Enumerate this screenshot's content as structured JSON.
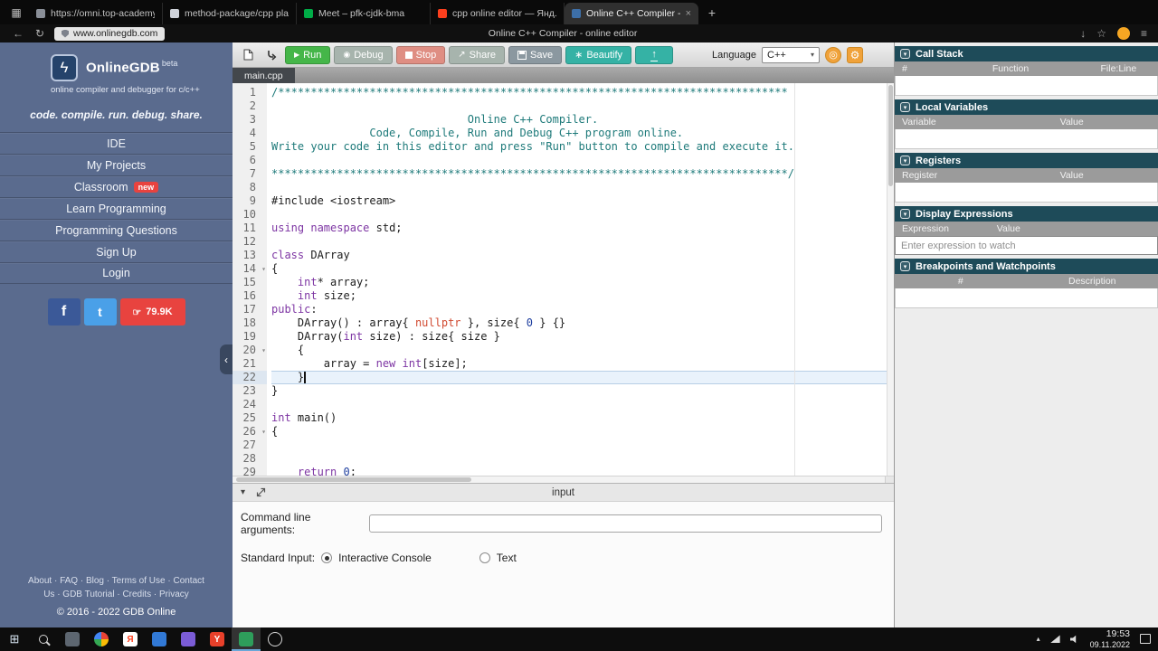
{
  "colors": {
    "run_green": "#45b649",
    "stop_red": "#df8e83",
    "neutral_btn": "#a7b4ad",
    "save_gray": "#8b98a0",
    "teal": "#35b2a5",
    "orange": "#f0a23a",
    "sidebar": "#5a6b8e",
    "badge_red": "#e8433f",
    "panel_header": "#1e4b59",
    "facebook": "#3b5998",
    "twitter": "#4aa0e8"
  },
  "icons": {
    "window": "▦",
    "plus": "+",
    "close": "×",
    "back": "←",
    "refresh": "↻",
    "star": "☆",
    "download": "↓",
    "menu": "≡",
    "facebook": "f",
    "twitter": "t",
    "hand": "☞",
    "play": "▶",
    "gear": "⚙",
    "coin": "◎",
    "chevron_down": "▾",
    "chevron_left": "‹",
    "chevron_up": "▴",
    "start": "⊞",
    "bolt": "ϟ",
    "beautify": "∗",
    "share": "↗",
    "debug": "◉"
  },
  "browser": {
    "tabs": [
      {
        "title": "https://omni.top-academy",
        "fav": "#8a8f98",
        "active": false
      },
      {
        "title": "method-package/cpp plan",
        "fav": "#cfd3da",
        "active": false
      },
      {
        "title": "Meet – pfk-cjdk-bma",
        "fav": "#00ac47",
        "active": false
      },
      {
        "title": "cpp online editor — Янд...",
        "fav": "#fc3f1d",
        "active": false
      },
      {
        "title": "Online C++ Compiler - o...",
        "fav": "#3d6fa8",
        "active": true
      }
    ],
    "url": "www.onlinegdb.com",
    "page_title": "Online C++ Compiler - online editor"
  },
  "sidebar": {
    "brand": "OnlineGDB",
    "beta": "beta",
    "brand_sub": "online compiler and debugger for c/c++",
    "tagline": "code. compile. run. debug. share.",
    "menu": [
      {
        "label": "IDE"
      },
      {
        "label": "My Projects"
      },
      {
        "label": "Classroom",
        "badge": "new"
      },
      {
        "label": "Learn Programming"
      },
      {
        "label": "Programming Questions"
      },
      {
        "label": "Sign Up"
      },
      {
        "label": "Login"
      }
    ],
    "like_count": "79.9K",
    "footer_links": [
      "About",
      "FAQ",
      "Blog",
      "Terms of Use",
      "Contact Us",
      "GDB Tutorial",
      "Credits",
      "Privacy"
    ],
    "copyright": "© 2016 - 2022 GDB Online"
  },
  "toolbar": {
    "run": "Run",
    "debug": "Debug",
    "stop": "Stop",
    "share": "Share",
    "save": "Save",
    "beautify": "Beautify",
    "language_label": "Language",
    "language_value": "C++"
  },
  "editor": {
    "file_tab": "main.cpp",
    "cursor_line": 22,
    "cursor_col": 5,
    "fold_lines": [
      14,
      20,
      26
    ],
    "token_colors": {
      "c": "#1e7a7a",
      "k": "#7d35a3",
      "v": "#d14b32",
      "n": "#2040a0",
      "t": "#1d1d1d"
    },
    "lines": [
      [
        [
          "c",
          "/******************************************************************************"
        ]
      ],
      [],
      [
        [
          "c",
          "                              Online C++ Compiler."
        ]
      ],
      [
        [
          "c",
          "               Code, Compile, Run and Debug C++ program online."
        ]
      ],
      [
        [
          "c",
          "Write your code in this editor and press \"Run\" button to compile and execute it."
        ]
      ],
      [],
      [
        [
          "c",
          "*******************************************************************************/"
        ]
      ],
      [],
      [
        [
          "t",
          "#include <iostream>"
        ]
      ],
      [],
      [
        [
          "k",
          "using"
        ],
        [
          "t",
          " "
        ],
        [
          "k",
          "namespace"
        ],
        [
          "t",
          " std;"
        ]
      ],
      [],
      [
        [
          "k",
          "class"
        ],
        [
          "t",
          " DArray"
        ]
      ],
      [
        [
          "t",
          "{"
        ]
      ],
      [
        [
          "t",
          "    "
        ],
        [
          "k",
          "int"
        ],
        [
          "t",
          "* array;"
        ]
      ],
      [
        [
          "t",
          "    "
        ],
        [
          "k",
          "int"
        ],
        [
          "t",
          " size;"
        ]
      ],
      [
        [
          "k",
          "public"
        ],
        [
          "t",
          ":"
        ]
      ],
      [
        [
          "t",
          "    DArray() : array{ "
        ],
        [
          "v",
          "nullptr"
        ],
        [
          "t",
          " }, size{ "
        ],
        [
          "n",
          "0"
        ],
        [
          "t",
          " } {}"
        ]
      ],
      [
        [
          "t",
          "    DArray("
        ],
        [
          "k",
          "int"
        ],
        [
          "t",
          " size) : size{ size }"
        ]
      ],
      [
        [
          "t",
          "    {"
        ]
      ],
      [
        [
          "t",
          "        array = "
        ],
        [
          "k",
          "new"
        ],
        [
          "t",
          " "
        ],
        [
          "k",
          "int"
        ],
        [
          "t",
          "[size];"
        ]
      ],
      [
        [
          "t",
          "    }"
        ]
      ],
      [
        [
          "t",
          "}"
        ]
      ],
      [],
      [
        [
          "k",
          "int"
        ],
        [
          "t",
          " main()"
        ]
      ],
      [
        [
          "t",
          "{"
        ]
      ],
      [],
      [],
      [
        [
          "t",
          "    "
        ],
        [
          "k",
          "return"
        ],
        [
          "t",
          " "
        ],
        [
          "n",
          "0"
        ],
        [
          "t",
          ";"
        ]
      ]
    ]
  },
  "debug_panel": {
    "sections": [
      {
        "title": "Call Stack",
        "cols": [
          "#",
          "Function",
          "File:Line"
        ],
        "col_widths": [
          "18%",
          "52%",
          "30%"
        ],
        "col_aligns": [
          "left",
          "center",
          "center"
        ]
      },
      {
        "title": "Local Variables",
        "cols": [
          "Variable",
          "Value"
        ],
        "col_widths": [
          "60%",
          "40%"
        ],
        "col_aligns": [
          "left",
          "left"
        ]
      },
      {
        "title": "Registers",
        "cols": [
          "Register",
          "Value"
        ],
        "col_widths": [
          "60%",
          "40%"
        ],
        "col_aligns": [
          "left",
          "left"
        ]
      },
      {
        "title": "Display Expressions",
        "cols": [
          "Expression",
          "Value"
        ],
        "col_widths": [
          "36%",
          "64%"
        ],
        "col_aligns": [
          "left",
          "left"
        ],
        "input_placeholder": "Enter expression to watch"
      },
      {
        "title": "Breakpoints and Watchpoints",
        "cols": [
          "#",
          "Description"
        ],
        "col_widths": [
          "50%",
          "50%"
        ],
        "col_aligns": [
          "center",
          "center"
        ]
      }
    ]
  },
  "bottom_panel": {
    "title": "input",
    "cmd_label": "Command line arguments:",
    "cmd_value": "",
    "stdin_label": "Standard Input:",
    "options": [
      {
        "label": "Interactive Console",
        "selected": true
      },
      {
        "label": "Text",
        "selected": false
      }
    ]
  },
  "taskbar": {
    "apps": [
      {
        "name": "taskbar-app-1",
        "type": "square",
        "bg": "#5d6670",
        "glyph": "",
        "fg": "#fff"
      },
      {
        "name": "taskbar-app-browser",
        "type": "chrome",
        "glyph": ""
      },
      {
        "name": "taskbar-app-yandex",
        "type": "square",
        "bg": "#ffffff",
        "glyph": "Я",
        "fg": "#fc3f1d"
      },
      {
        "name": "taskbar-app-4",
        "type": "square",
        "bg": "#3179d6",
        "glyph": "",
        "fg": "#fff"
      },
      {
        "name": "taskbar-app-5",
        "type": "square",
        "bg": "#7b5cd6",
        "glyph": "",
        "fg": "#fff"
      },
      {
        "name": "taskbar-app-6",
        "type": "square",
        "bg": "#e8402a",
        "glyph": "Y",
        "fg": "#fff"
      },
      {
        "name": "taskbar-app-active",
        "type": "square",
        "bg": "#2e9e5b",
        "glyph": "",
        "fg": "#fff",
        "active": true
      },
      {
        "name": "taskbar-app-clock",
        "type": "circle",
        "glyph": ""
      }
    ],
    "time": "19:53",
    "date": "09.11.2022"
  }
}
